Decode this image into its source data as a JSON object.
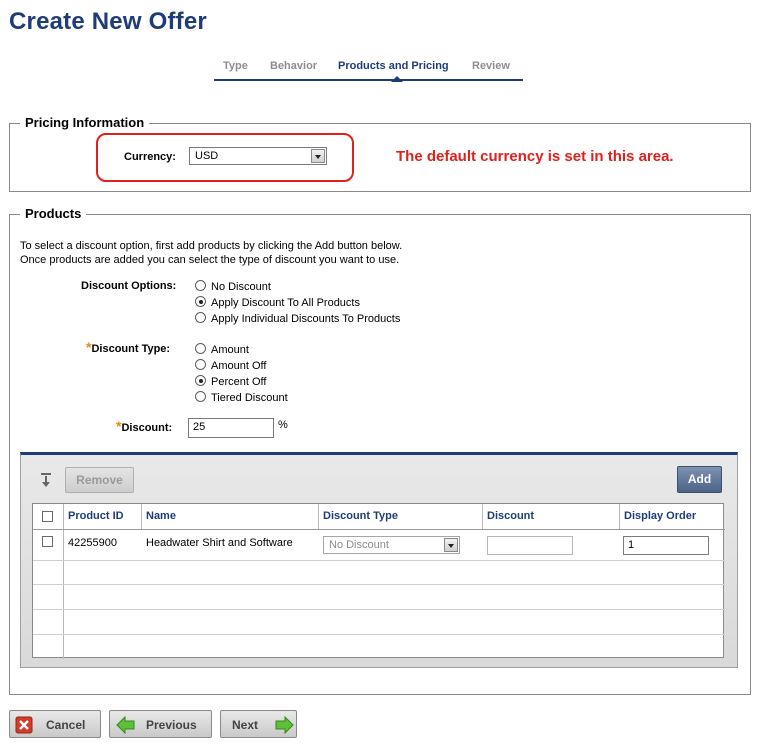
{
  "page": {
    "title": "Create New Offer"
  },
  "steps": [
    {
      "label": "Type",
      "active": false
    },
    {
      "label": "Behavior",
      "active": false
    },
    {
      "label": "Products and Pricing",
      "active": true
    },
    {
      "label": "Review",
      "active": false
    }
  ],
  "pricing": {
    "legend": "Pricing Information",
    "currency_label": "Currency:",
    "currency_value": "USD",
    "note": "The default currency is set in this area."
  },
  "products": {
    "legend": "Products",
    "instructions": [
      "To select a discount option, first add products by clicking the Add button below.",
      "Once products are added you can select the type of discount you want to use."
    ],
    "discount_options_label": "Discount Options:",
    "discount_options": [
      {
        "label": "No Discount",
        "selected": false
      },
      {
        "label": "Apply Discount To All Products",
        "selected": true
      },
      {
        "label": "Apply Individual Discounts To Products",
        "selected": false
      }
    ],
    "discount_type_label": "Discount Type:",
    "discount_types": [
      {
        "label": "Amount",
        "selected": false
      },
      {
        "label": "Amount Off",
        "selected": false
      },
      {
        "label": "Percent Off",
        "selected": true
      },
      {
        "label": "Tiered Discount",
        "selected": false
      }
    ],
    "discount_label": "Discount:",
    "discount_value": "25",
    "discount_unit": "%",
    "required_marker": "*"
  },
  "grid": {
    "remove_label": "Remove",
    "add_label": "Add",
    "columns": [
      "Product ID",
      "Name",
      "Discount Type",
      "Discount",
      "Display Order"
    ],
    "rows": [
      {
        "product_id": "42255900",
        "name": "Headwater Shirt and Software",
        "discount_type": "No Discount",
        "discount": "",
        "display_order": "1"
      }
    ]
  },
  "footer": {
    "cancel_label": "Cancel",
    "previous_label": "Previous",
    "next_label": "Next"
  },
  "colors": {
    "title_blue": "#1f3c7a",
    "callout_red": "#e0201c",
    "required_orange": "#e08a1c",
    "add_button": "#5a6f92"
  }
}
